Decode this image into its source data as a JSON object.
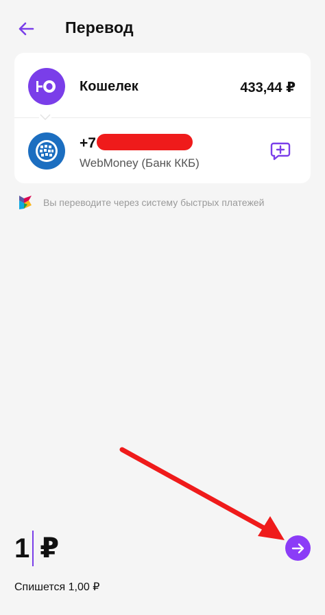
{
  "header": {
    "title": "Перевод"
  },
  "source": {
    "name": "Кошелек",
    "balance": "433,44 ₽",
    "logo_text": "ЮО"
  },
  "recipient": {
    "phone_prefix": "+7",
    "bank": "WebMoney (Банк ККБ)"
  },
  "sbp_notice": "Вы переводите через систему быстрых платежей",
  "amount": {
    "value": "1",
    "currency": "₽",
    "debit_note": "Спишется 1,00 ₽"
  },
  "icons": {
    "back": "arrow-left-icon",
    "message": "message-plus-icon",
    "next": "arrow-right-icon",
    "sbp": "sbp-logo-icon",
    "webmoney": "webmoney-globe-icon",
    "wallet": "yoomoney-logo-icon"
  },
  "colors": {
    "accent": "#7a3ee9",
    "webmoney": "#1c6ec0",
    "annotation": "#ef1b1b"
  }
}
